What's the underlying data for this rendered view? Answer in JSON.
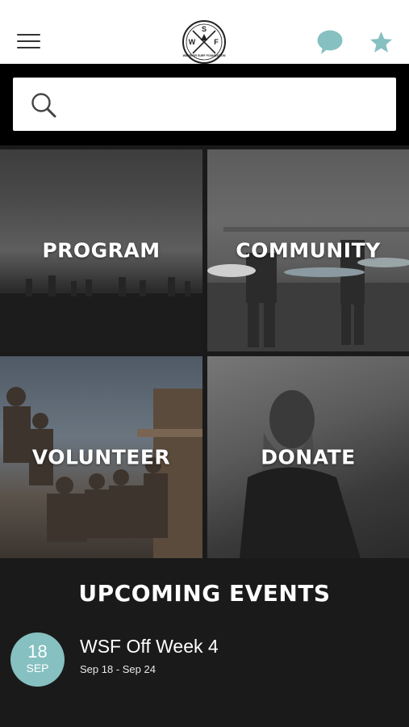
{
  "colors": {
    "accent": "#86c0c0",
    "header_bg": "#ffffff",
    "band_bg": "#000000",
    "events_bg": "#1a1a1a"
  },
  "header": {
    "menu_icon": "hamburger-menu-icon",
    "logo_letters": [
      "S",
      "W",
      "F"
    ],
    "logo_text": "WARRIOR SURF FOUNDATION",
    "chat_icon": "chat-bubble-icon",
    "favorite_icon": "star-icon"
  },
  "search": {
    "icon": "search-icon",
    "placeholder": "",
    "value": ""
  },
  "tiles": [
    {
      "label": "PROGRAM"
    },
    {
      "label": "COMMUNITY"
    },
    {
      "label": "VOLUNTEER"
    },
    {
      "label": "DONATE"
    }
  ],
  "events": {
    "title": "UPCOMING EVENTS",
    "items": [
      {
        "day": "18",
        "month": "SEP",
        "name": "WSF Off Week 4",
        "range": "Sep 18 - Sep 24"
      }
    ]
  }
}
